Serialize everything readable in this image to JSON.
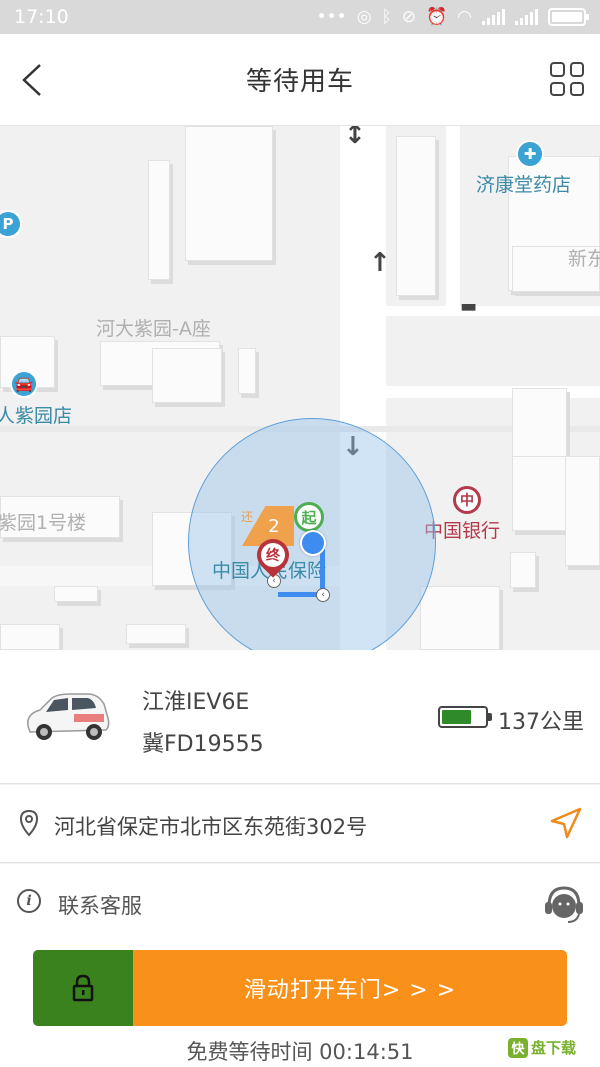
{
  "status_bar": {
    "time": "17:10"
  },
  "header": {
    "title": "等待用车"
  },
  "map": {
    "labels": {
      "pharmacy": "济康堂药店",
      "new_east": "新东",
      "hedazi_a": "河大紫园-A座",
      "renzi_store": "人紫园店",
      "ziyuan_1": "紫园1号楼",
      "bank": "中国银行",
      "insurance": "中国人民保险"
    },
    "markers": {
      "start": "起",
      "end": "终",
      "return_count": "2",
      "return_label": "还"
    },
    "icons": [
      "parking-icon",
      "pharmacy-icon",
      "car-service-icon",
      "bank-icon"
    ]
  },
  "vehicle": {
    "model": "江淮IEV6E",
    "plate": "冀FD19555",
    "battery_level": 0.7,
    "range": "137公里"
  },
  "address": {
    "text": "河北省保定市北市区东苑街302号"
  },
  "support": {
    "label": "联系客服"
  },
  "slider": {
    "label": "滑动打开车门> > >"
  },
  "wait": {
    "text": "免费等待时间 00:14:51"
  },
  "watermark": {
    "brand": "快",
    "text": "盘下载"
  },
  "colors": {
    "accent": "#f8901a",
    "handle": "#3a821e",
    "battery_fill": "#2f8a2a",
    "location": "#3f8cf0"
  }
}
